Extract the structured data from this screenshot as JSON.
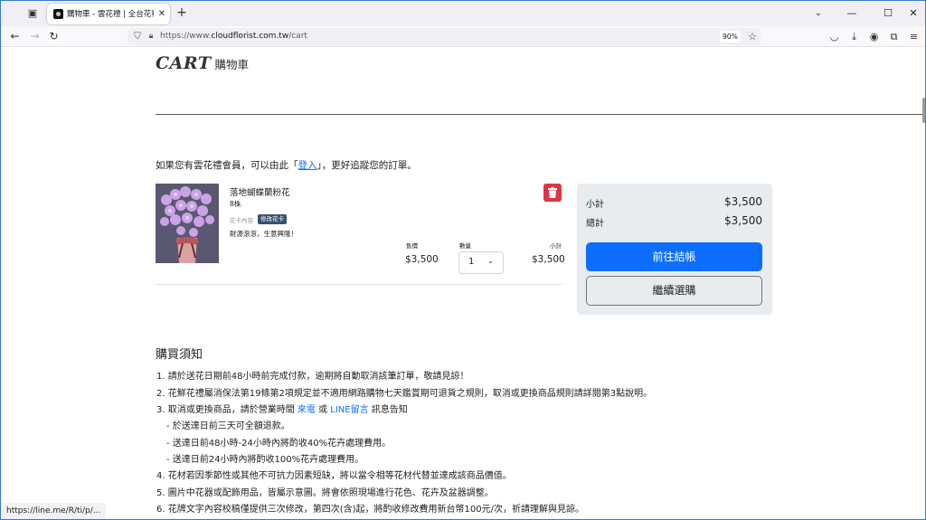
{
  "browser": {
    "tab": {
      "title": "購物車 - 雲花禮 | 全台花禮配送"
    },
    "url": {
      "prefix": "https://www.",
      "host": "cloudflorist.com.tw",
      "path": "/cart"
    },
    "zoom": "90%"
  },
  "page": {
    "heading_en": "CART",
    "heading_zh": "購物車",
    "member_note": {
      "before": "如果您有雲花禮會員，可以由此「",
      "link": "登入",
      "after": "」，更好追蹤您的訂單。"
    },
    "item": {
      "name": "落地蝴蝶蘭粉花",
      "qty_label": "8株",
      "card_label": "花卡內容",
      "card_edit_button": "修改花卡",
      "card_message": "財源滾滾，生意興隆！",
      "price_label": "售價",
      "price": "$3,500",
      "quantity_label": "數量",
      "quantity": "1",
      "subtotal_label": "小計",
      "subtotal": "$3,500"
    },
    "summary": {
      "subtotal_label": "小計",
      "subtotal": "$3,500",
      "total_label": "總計",
      "total": "$3,500",
      "checkout_button": "前往結帳",
      "continue_button": "繼續選購"
    },
    "notes": {
      "title": "購買須知",
      "line1": "1. 請於送花日期前48小時前完成付款，逾期將自動取消該筆訂單，敬請見諒！",
      "line2": "2. 花鮮花禮屬消保法第19條第2項規定並不適用網路購物七天鑑賞期可退貨之規則，取消或更換商品規則請詳閱第3點說明。",
      "line3_before": "3. 取消或更換商品，請於營業時間 ",
      "line3_link1": "來電",
      "line3_mid": " 或 ",
      "line3_link2": "LINE留言",
      "line3_after": " 訊息告知",
      "line3a": "- 於送達日前三天可全額退款。",
      "line3b": "- 送達日前48小時-24小時內將酌收40%花卉處理費用。",
      "line3c": "- 送達日前24小時內將酌收100%花卉處理費用。",
      "line4": "4. 花材若因季節性或其他不可抗力因素短缺，將以當令相等花材代替並達成該商品價值。",
      "line5": "5. 圖片中花器或配飾用品，皆屬示意圖。將會依照現場進行花色、花卉及盆器調整。",
      "line6": "6. 花牌文字內容校稿僅提供三次修改，第四次(含)起，將酌收修改費用新台幣100元/次，祈請理解與見諒。"
    },
    "status_url": "https://line.me/R/ti/p/..."
  }
}
